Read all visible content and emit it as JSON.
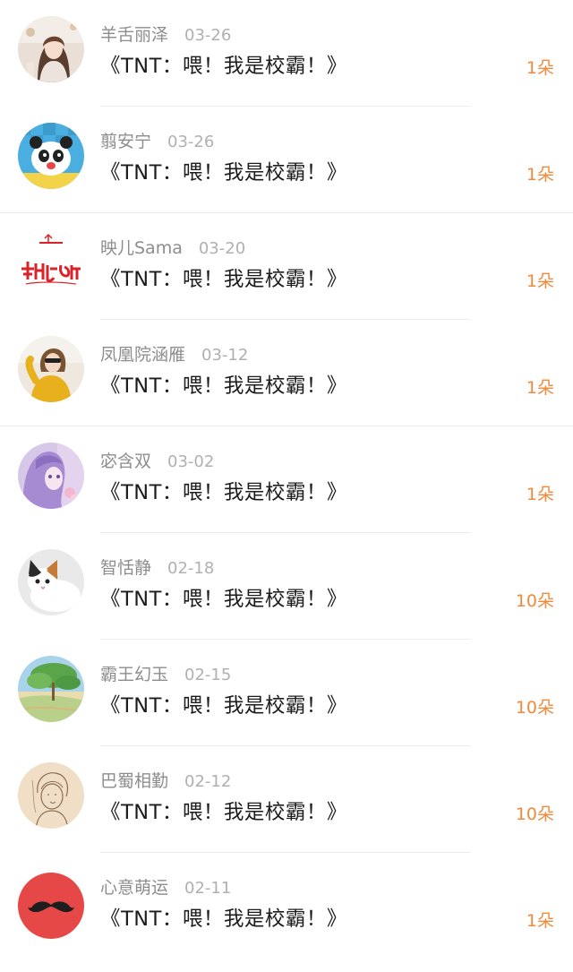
{
  "entries": [
    {
      "name": "羊舌丽泽",
      "date": "03-26",
      "title": "《TNT：喂！我是校霸！》",
      "count": "1朵",
      "avatar_icon": "girl-photo-avatar",
      "avatar_color": "#d8c7b6"
    },
    {
      "name": "翦安宁",
      "date": "03-26",
      "title": "《TNT：喂！我是校霸！》",
      "count": "1朵",
      "avatar_icon": "panda-avatar",
      "avatar_color": "#41a8d8"
    },
    {
      "name": "映儿Sama",
      "date": "03-20",
      "title": "《TNT：喂！我是校霸！》",
      "count": "1朵",
      "avatar_icon": "handwriting-logo-avatar",
      "avatar_color": "#d9232a"
    },
    {
      "name": "凤凰院涵雁",
      "date": "03-12",
      "title": "《TNT：喂！我是校霸！》",
      "count": "1朵",
      "avatar_icon": "yellow-sweater-avatar",
      "avatar_color": "#e8b41e"
    },
    {
      "name": "宓含双",
      "date": "03-02",
      "title": "《TNT：喂！我是校霸！》",
      "count": "1朵",
      "avatar_icon": "anime-girl-avatar",
      "avatar_color": "#b9a0d8"
    },
    {
      "name": "智恬静",
      "date": "02-18",
      "title": "《TNT：喂！我是校霸！》",
      "count": "10朵",
      "avatar_icon": "cat-avatar",
      "avatar_color": "#eaeaea"
    },
    {
      "name": "霸王幻玉",
      "date": "02-15",
      "title": "《TNT：喂！我是校霸！》",
      "count": "10朵",
      "avatar_icon": "landscape-avatar",
      "avatar_color": "#8cc3de"
    },
    {
      "name": "巴蜀相勤",
      "date": "02-12",
      "title": "《TNT：喂！我是校霸！》",
      "count": "10朵",
      "avatar_icon": "sketch-avatar",
      "avatar_color": "#ecd9bf"
    },
    {
      "name": "心意萌运",
      "date": "02-11",
      "title": "《TNT：喂！我是校霸！》",
      "count": "1朵",
      "avatar_icon": "mustache-avatar",
      "avatar_color": "#e64848"
    }
  ]
}
